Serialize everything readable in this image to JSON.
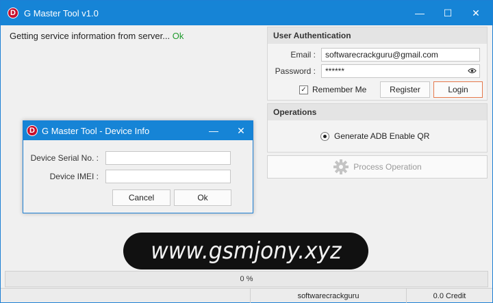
{
  "window": {
    "title": "G Master Tool v1.0",
    "logo_letter": "D",
    "controls": {
      "minimize": "—",
      "maximize": "☐",
      "close": "✕"
    }
  },
  "status": {
    "message": "Getting service information from server... ",
    "result": "Ok"
  },
  "auth": {
    "header": "User Authentication",
    "email_label": "Email :",
    "email_value": "softwarecrackguru@gmail.com",
    "password_label": "Password :",
    "password_value": "******",
    "remember_label": "Remember Me",
    "remember_checked": true,
    "register_label": "Register",
    "login_label": "Login"
  },
  "operations": {
    "header": "Operations",
    "option_label": "Generate ADB Enable QR",
    "process_label": "Process Operation"
  },
  "progress": {
    "text": "0 %",
    "value": 0
  },
  "statusbar": {
    "user": "softwarecrackguru",
    "credit": "0.0 Credit"
  },
  "dialog": {
    "title": "G Master Tool - Device Info",
    "logo_letter": "D",
    "minimize": "—",
    "close": "✕",
    "serial_label": "Device Serial No. :",
    "serial_value": "",
    "imei_label": "Device IMEI :",
    "imei_value": "",
    "cancel_label": "Cancel",
    "ok_label": "Ok"
  },
  "watermark": {
    "text": "www.gsmjony.xyz"
  },
  "colors": {
    "titlebar": "#1684d6",
    "logo": "#c8102e",
    "ok_text": "#1e9a2c",
    "login_border": "#e5784b"
  }
}
